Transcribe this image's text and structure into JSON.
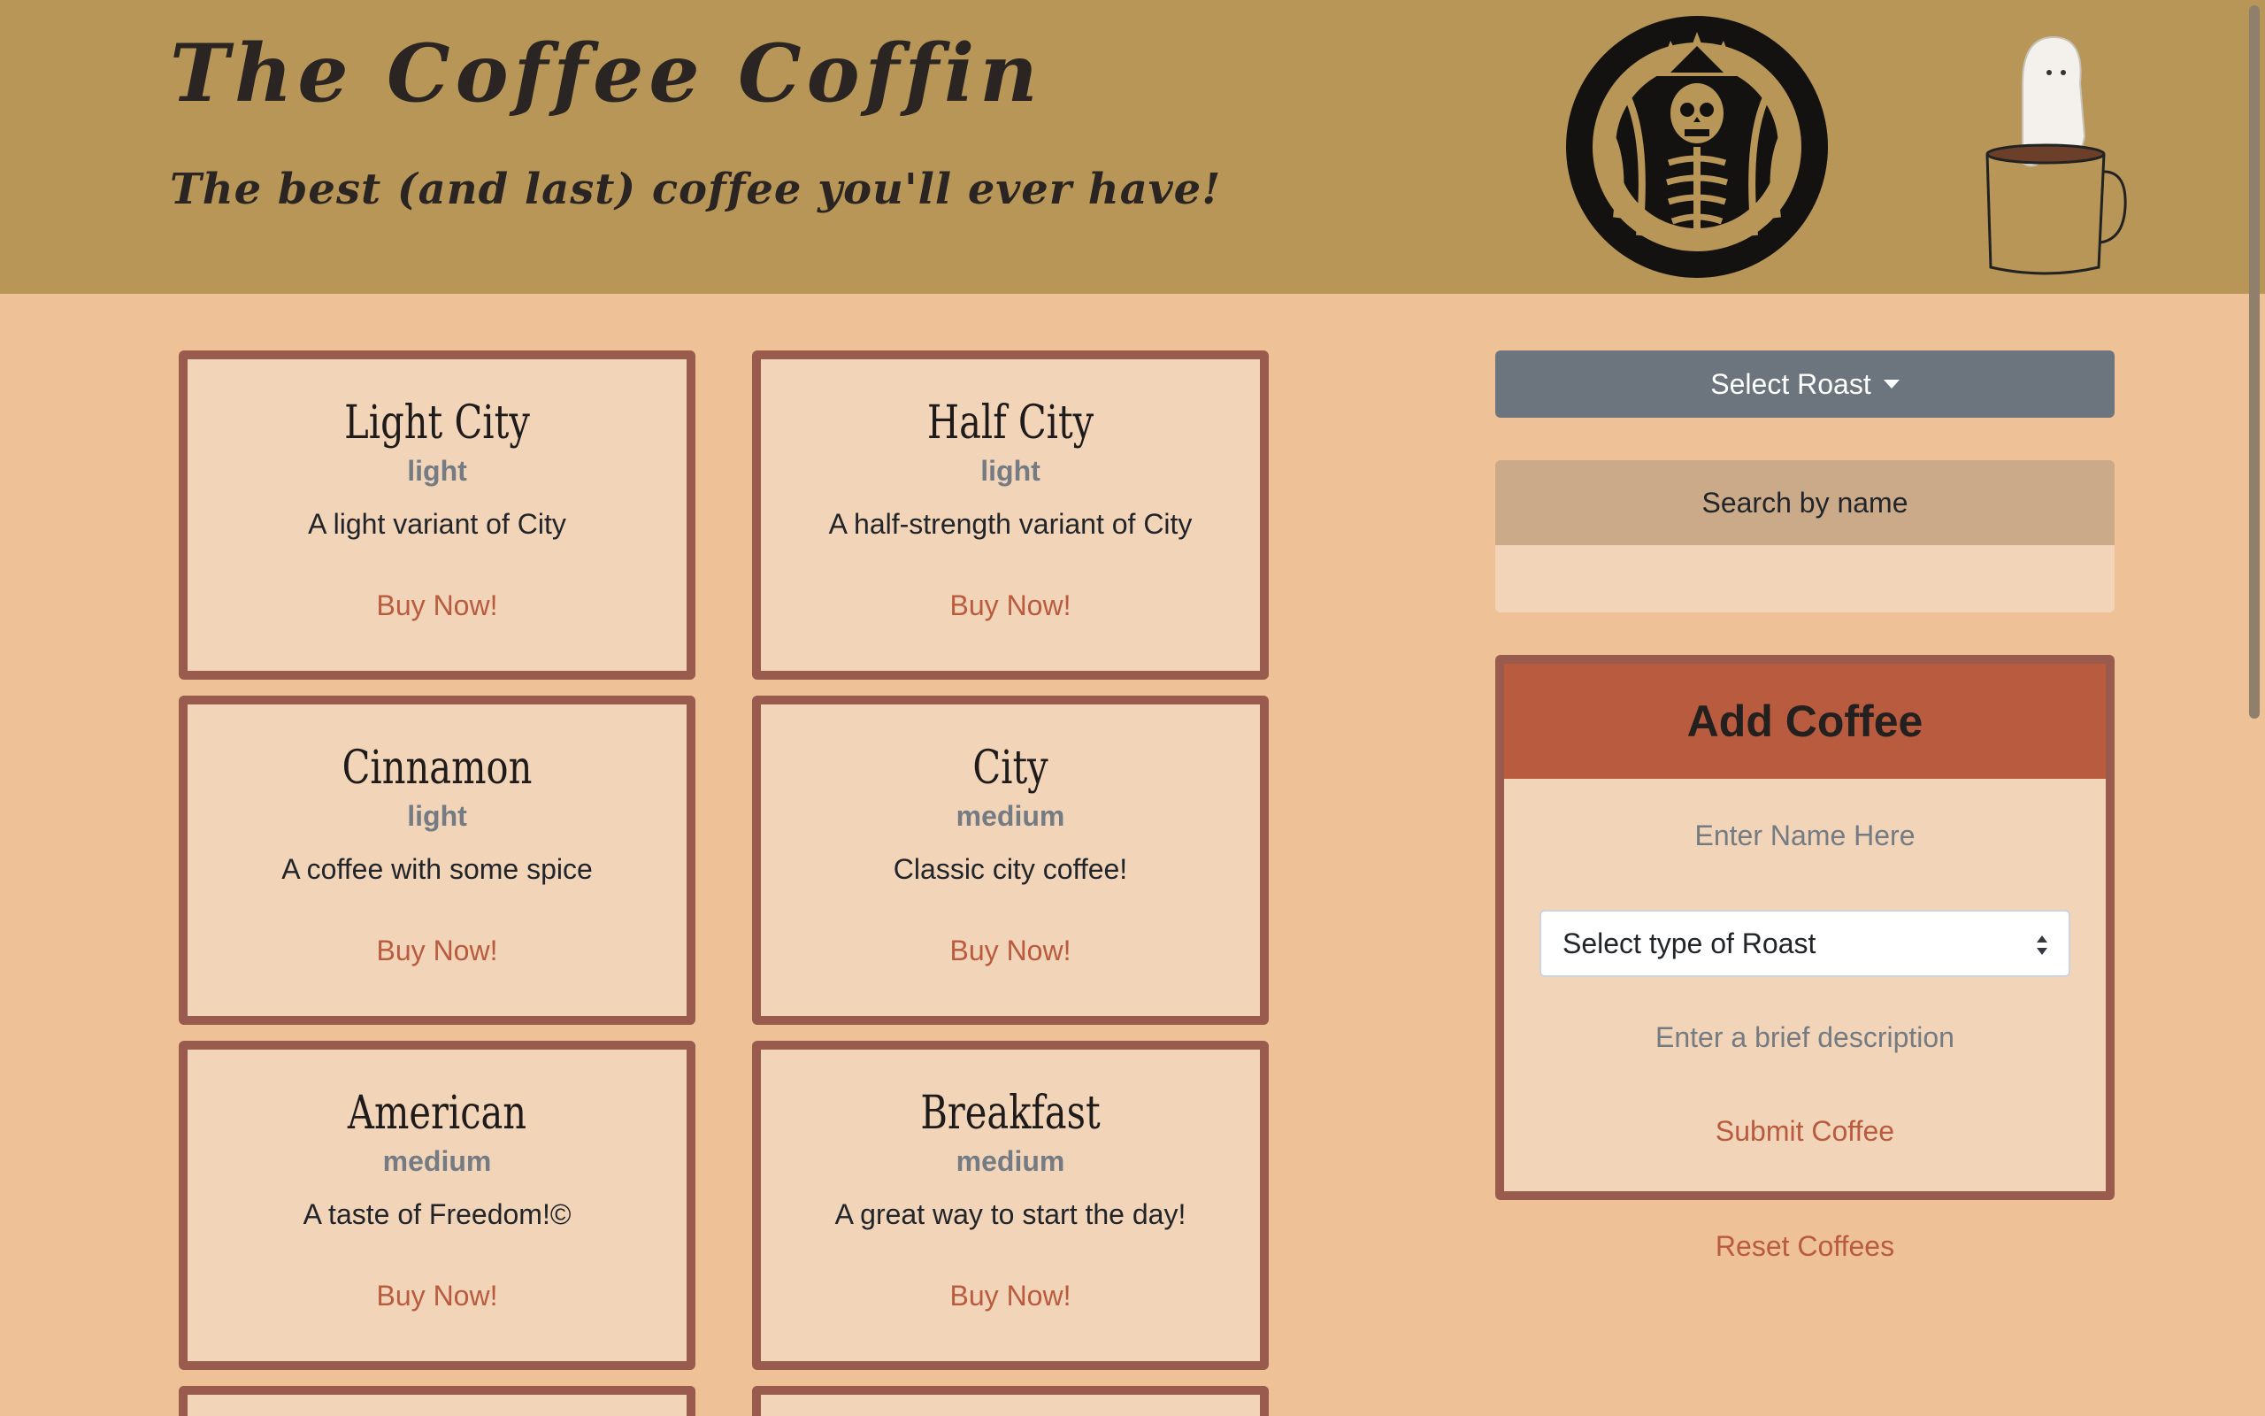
{
  "header": {
    "title": "The Coffee Coffin",
    "tagline": "The best (and last) coffee you'll ever have!"
  },
  "coffees": [
    {
      "name": "Light City",
      "roast": "light",
      "description": "A light variant of City",
      "buy_label": "Buy Now!"
    },
    {
      "name": "Half City",
      "roast": "light",
      "description": "A half-strength variant of City",
      "buy_label": "Buy Now!"
    },
    {
      "name": "Cinnamon",
      "roast": "light",
      "description": "A coffee with some spice",
      "buy_label": "Buy Now!"
    },
    {
      "name": "City",
      "roast": "medium",
      "description": "Classic city coffee!",
      "buy_label": "Buy Now!"
    },
    {
      "name": "American",
      "roast": "medium",
      "description": "A taste of Freedom!©",
      "buy_label": "Buy Now!"
    },
    {
      "name": "Breakfast",
      "roast": "medium",
      "description": "A great way to start the day!",
      "buy_label": "Buy Now!"
    }
  ],
  "sidebar": {
    "select_roast_label": "Select Roast",
    "search_label": "Search by name",
    "search_value": "",
    "add_coffee": {
      "title": "Add Coffee",
      "name_placeholder": "Enter Name Here",
      "roast_select_label": "Select type of Roast",
      "description_placeholder": "Enter a brief description",
      "submit_label": "Submit Coffee"
    },
    "reset_label": "Reset Coffees"
  },
  "colors": {
    "header_bg": "#b89658",
    "page_bg": "#eec196",
    "card_bg": "#f2d4b9",
    "card_border": "#9a5b4f",
    "accent": "#b85b3e",
    "button_gray": "#6c757d"
  },
  "icons": {
    "logo": "skeleton-siren-logo",
    "mug": "ghost-coffee-mug-icon",
    "dropdown": "caret-down-icon",
    "select": "updown-arrows-icon"
  }
}
